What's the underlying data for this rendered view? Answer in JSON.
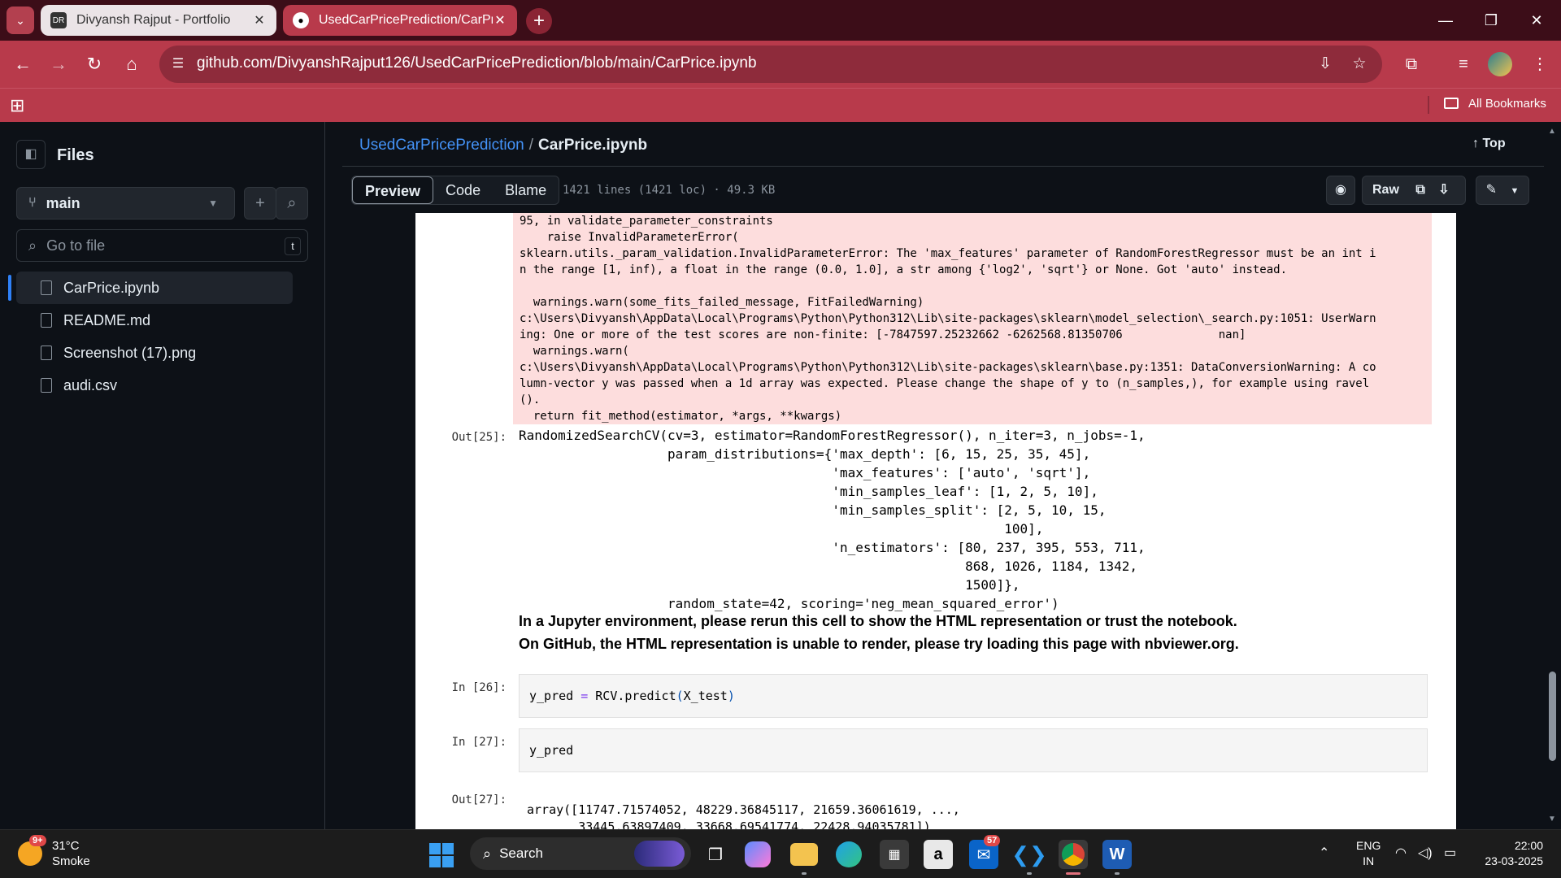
{
  "browser": {
    "tabs": [
      {
        "title": "Divyansh Rajput - Portfolio",
        "favicon": "DR-favicon"
      },
      {
        "title": "UsedCarPricePrediction/CarPric",
        "favicon": "github-icon"
      }
    ],
    "url": "github.com/DivyanshRajput126/UsedCarPricePrediction/blob/main/CarPrice.ipynb",
    "bookmarks_label": "All Bookmarks",
    "theme_color": "#b83a4b"
  },
  "sidebar": {
    "title": "Files",
    "branch": "main",
    "search_placeholder": "Go to file",
    "search_shortcut": "t",
    "files": [
      "CarPrice.ipynb",
      "README.md",
      "Screenshot (17).png",
      "audi.csv"
    ]
  },
  "header": {
    "repo": "UsedCarPricePrediction",
    "separator": "/",
    "file": "CarPrice.ipynb",
    "top_label": "Top",
    "tabs": [
      "Preview",
      "Code",
      "Blame"
    ],
    "meta": "1421 lines (1421 loc) · 49.3 KB",
    "raw_label": "Raw"
  },
  "notebook": {
    "stderr": "95, in validate_parameter_constraints\n    raise InvalidParameterError(\nsklearn.utils._param_validation.InvalidParameterError: The 'max_features' parameter of RandomForestRegressor must be an int i\nn the range [1, inf), a float in the range (0.0, 1.0], a str among {'log2', 'sqrt'} or None. Got 'auto' instead.\n\n  warnings.warn(some_fits_failed_message, FitFailedWarning)\nc:\\Users\\Divyansh\\AppData\\Local\\Programs\\Python\\Python312\\Lib\\site-packages\\sklearn\\model_selection\\_search.py:1051: UserWarn\ning: One or more of the test scores are non-finite: [-7847597.25232662 -6262568.81350706              nan]\n  warnings.warn(\nc:\\Users\\Divyansh\\AppData\\Local\\Programs\\Python\\Python312\\Lib\\site-packages\\sklearn\\base.py:1351: DataConversionWarning: A co\nlumn-vector y was passed when a 1d array was expected. Please change the shape of y to (n_samples,), for example using ravel\n().\n  return fit_method(estimator, *args, **kwargs)",
    "out25_prompt": "Out[25]:",
    "out25_text": "RandomizedSearchCV(cv=3, estimator=RandomForestRegressor(), n_iter=3, n_jobs=-1,\n                   param_distributions={'max_depth': [6, 15, 25, 35, 45],\n                                        'max_features': ['auto', 'sqrt'],\n                                        'min_samples_leaf': [1, 2, 5, 10],\n                                        'min_samples_split': [2, 5, 10, 15,\n                                                              100],\n                                        'n_estimators': [80, 237, 395, 553, 711,\n                                                         868, 1026, 1184, 1342,\n                                                         1500]},\n                   random_state=42, scoring='neg_mean_squared_error')",
    "html_warning_1": "In a Jupyter environment, please rerun this cell to show the HTML representation or trust the notebook.",
    "html_warning_2": "On GitHub, the HTML representation is unable to render, please try loading this page with nbviewer.org.",
    "in26_prompt": "In [26]:",
    "in26_lhs": "y_pred ",
    "in26_op": "=",
    "in26_rhs": " RCV.predict",
    "in26_paren_open": "(",
    "in26_arg": "X_test",
    "in26_paren_close": ")",
    "in27_prompt": "In [27]:",
    "in27_code": "y_pred",
    "out27_prompt": "Out[27]:",
    "out27_text": "array([11747.71574052, 48229.36845117, 21659.36061619, ...,\n       33445.63897409, 33668.69541774, 22428.94035781])"
  },
  "taskbar": {
    "temperature": "31°C",
    "weather": "Smoke",
    "weather_badge": "9+",
    "search_label": "Search",
    "mail_badge": "57",
    "lang_1": "ENG",
    "lang_2": "IN",
    "time": "22:00",
    "date": "23-03-2025"
  }
}
